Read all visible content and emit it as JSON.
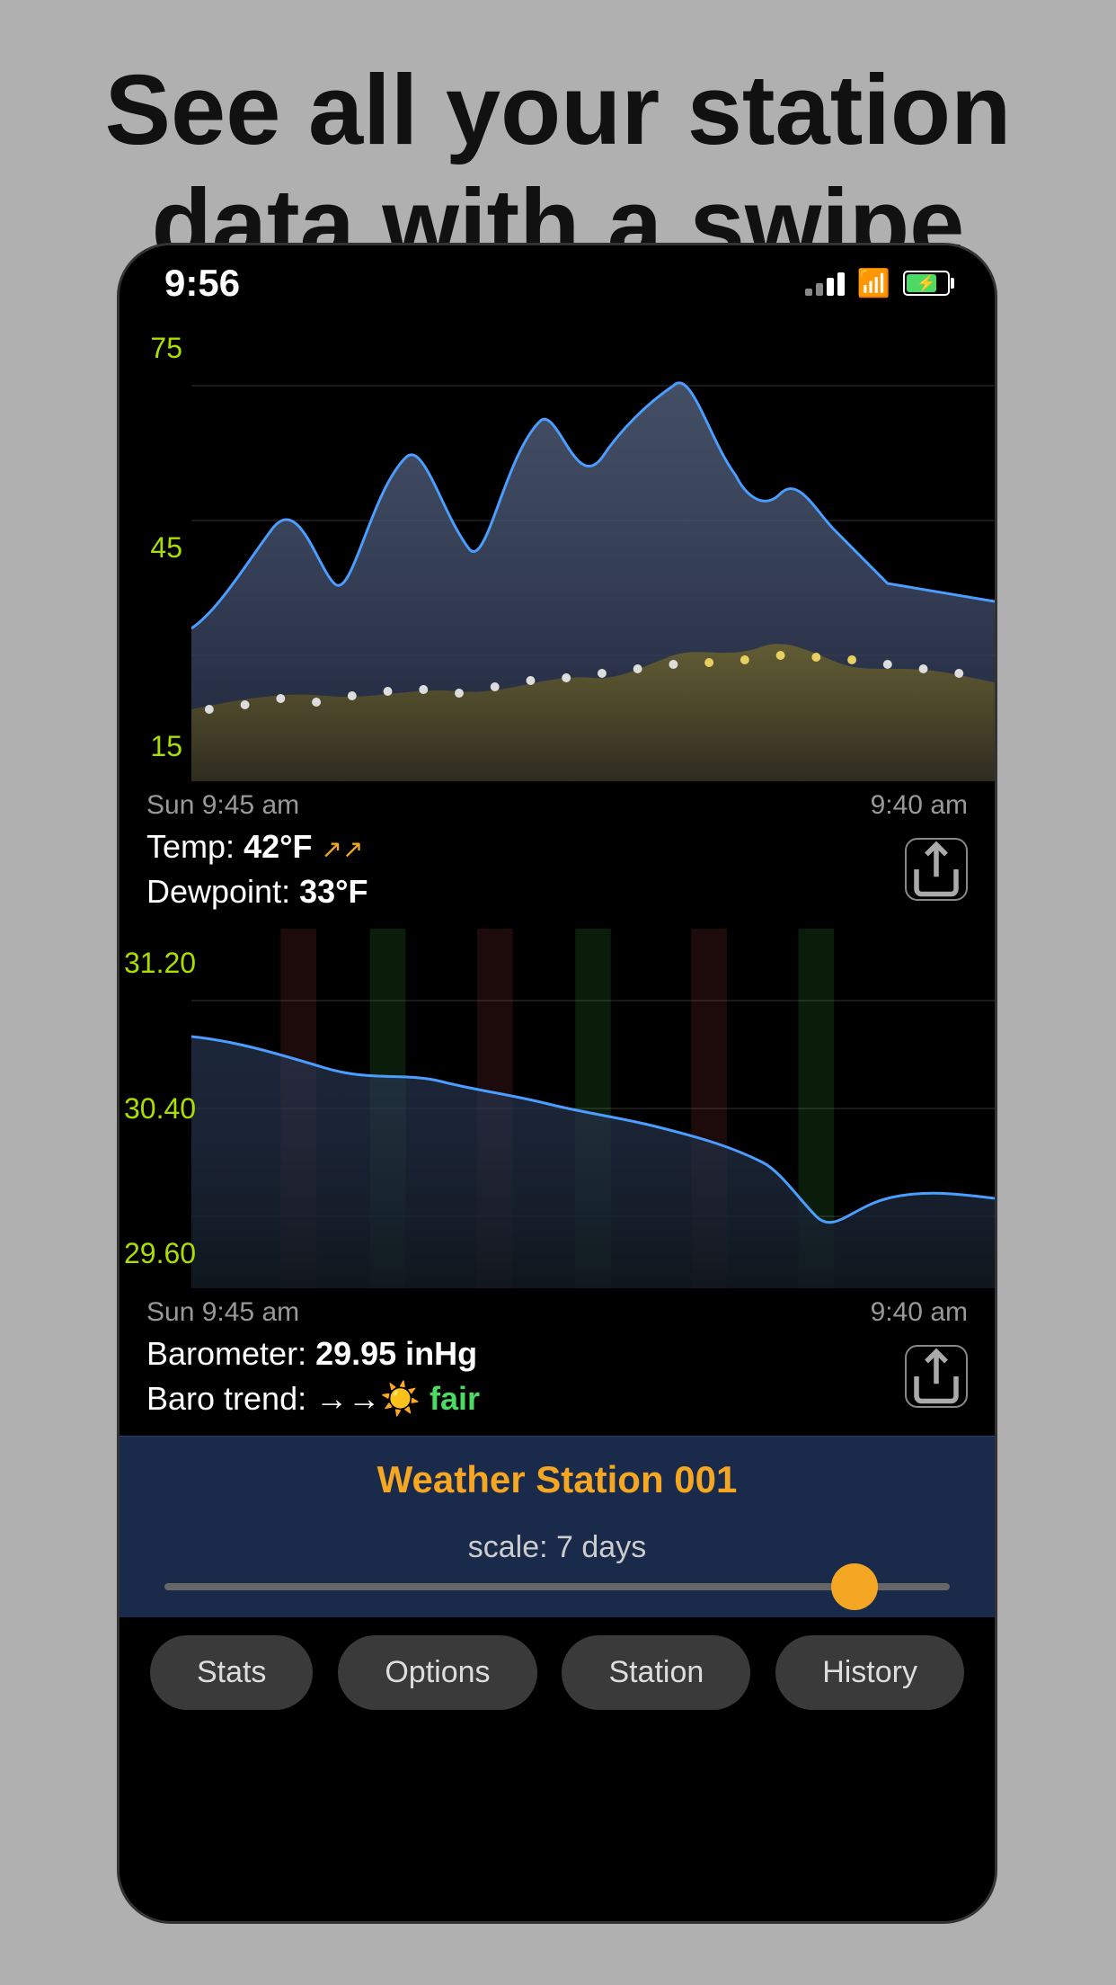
{
  "header": {
    "title": "See all your station data with a swipe"
  },
  "status_bar": {
    "time": "9:56",
    "signal_level": 2,
    "wifi": true,
    "battery_percent": 75
  },
  "temp_chart": {
    "y_labels": [
      "75",
      "45",
      "15"
    ],
    "time_start": "Sun 9:45 am",
    "time_end": "9:40 am",
    "temp_label": "Temp:",
    "temp_value": "42°F",
    "dewpoint_label": "Dewpoint:",
    "dewpoint_value": "33°F"
  },
  "baro_chart": {
    "y_labels": [
      "31.20",
      "30.40",
      "29.60"
    ],
    "time_start": "Sun 9:45 am",
    "time_end": "9:40 am",
    "baro_label": "Barometer:",
    "baro_value": "29.95 inHg",
    "trend_label": "Baro trend:",
    "trend_value": "→→☀️ fair"
  },
  "bottom_panel": {
    "station_name": "Weather Station 001",
    "scale_label": "scale: 7 days"
  },
  "tabs": [
    {
      "label": "Stats",
      "id": "stats"
    },
    {
      "label": "Options",
      "id": "options"
    },
    {
      "label": "Station",
      "id": "station"
    },
    {
      "label": "History",
      "id": "history"
    }
  ]
}
